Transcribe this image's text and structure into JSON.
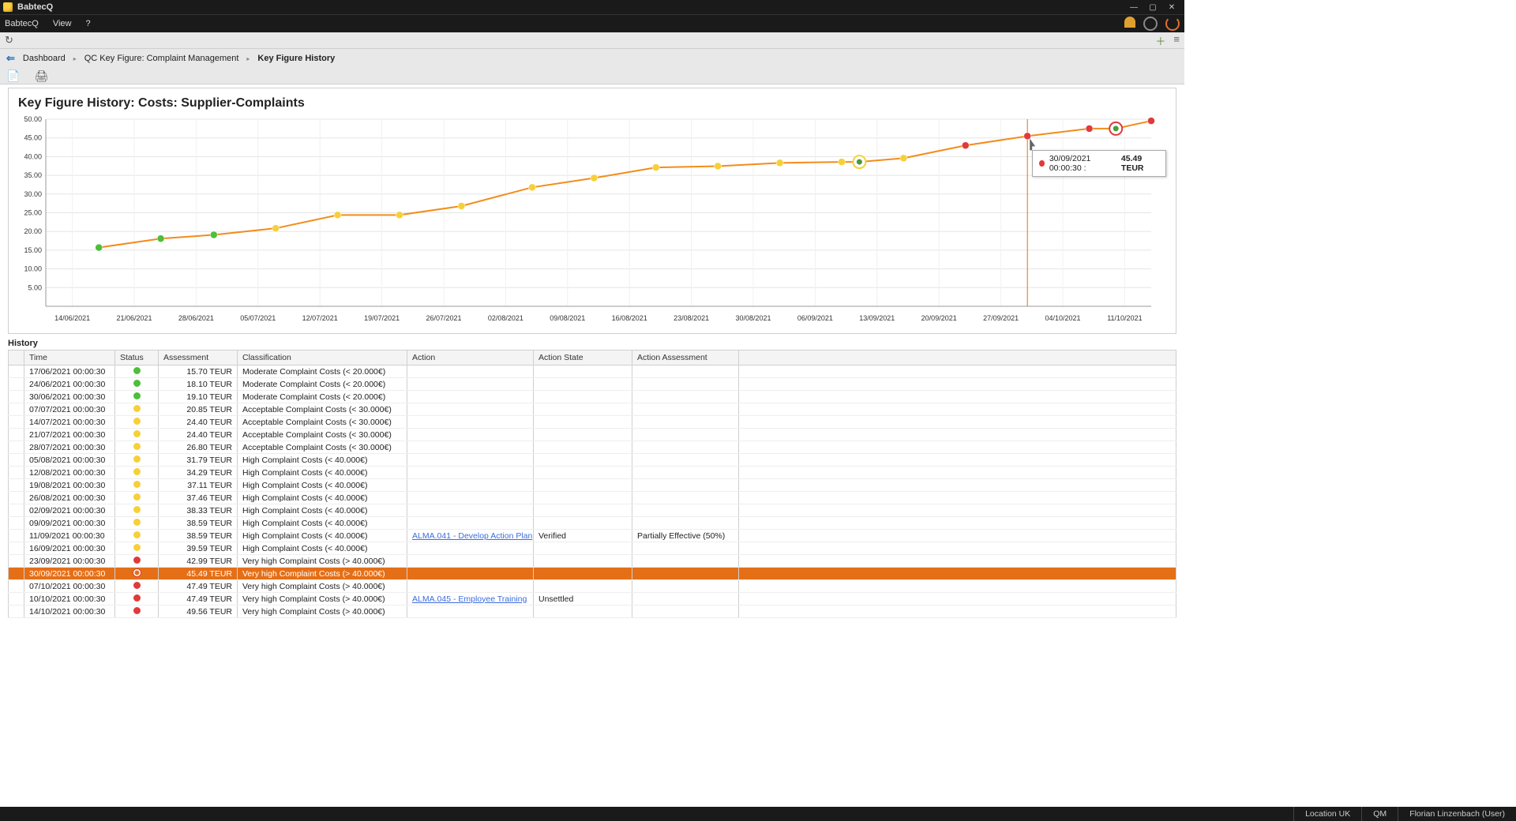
{
  "app": {
    "name": "BabtecQ"
  },
  "menu": {
    "items": [
      "BabtecQ",
      "View",
      "?"
    ]
  },
  "breadcrumb": {
    "items": [
      "Dashboard",
      "QC Key Figure: Complaint Management",
      "Key Figure History"
    ]
  },
  "page_title": "Key Figure History: Costs: Supplier-Complaints",
  "tooltip": {
    "label": "30/09/2021 00:00:30 :",
    "value": "45.49 TEUR"
  },
  "history_label": "History",
  "table": {
    "columns": [
      "",
      "Time",
      "Status",
      "Assessment",
      "Classification",
      "Action",
      "Action State",
      "Action Assessment",
      ""
    ],
    "rows": [
      {
        "time": "17/06/2021 00:00:30",
        "status": "green",
        "assessment": "15.70 TEUR",
        "classification": "Moderate Complaint Costs (< 20.000€)",
        "action": "",
        "action_state": "",
        "action_assessment": ""
      },
      {
        "time": "24/06/2021 00:00:30",
        "status": "green",
        "assessment": "18.10 TEUR",
        "classification": "Moderate Complaint Costs (< 20.000€)",
        "action": "",
        "action_state": "",
        "action_assessment": ""
      },
      {
        "time": "30/06/2021 00:00:30",
        "status": "green",
        "assessment": "19.10 TEUR",
        "classification": "Moderate Complaint Costs (< 20.000€)",
        "action": "",
        "action_state": "",
        "action_assessment": ""
      },
      {
        "time": "07/07/2021 00:00:30",
        "status": "yellow",
        "assessment": "20.85 TEUR",
        "classification": "Acceptable Complaint Costs (< 30.000€)",
        "action": "",
        "action_state": "",
        "action_assessment": ""
      },
      {
        "time": "14/07/2021 00:00:30",
        "status": "yellow",
        "assessment": "24.40 TEUR",
        "classification": "Acceptable Complaint Costs (< 30.000€)",
        "action": "",
        "action_state": "",
        "action_assessment": ""
      },
      {
        "time": "21/07/2021 00:00:30",
        "status": "yellow",
        "assessment": "24.40 TEUR",
        "classification": "Acceptable Complaint Costs (< 30.000€)",
        "action": "",
        "action_state": "",
        "action_assessment": ""
      },
      {
        "time": "28/07/2021 00:00:30",
        "status": "yellow",
        "assessment": "26.80 TEUR",
        "classification": "Acceptable Complaint Costs (< 30.000€)",
        "action": "",
        "action_state": "",
        "action_assessment": ""
      },
      {
        "time": "05/08/2021 00:00:30",
        "status": "yellow",
        "assessment": "31.79 TEUR",
        "classification": "High Complaint Costs (< 40.000€)",
        "action": "",
        "action_state": "",
        "action_assessment": ""
      },
      {
        "time": "12/08/2021 00:00:30",
        "status": "yellow",
        "assessment": "34.29 TEUR",
        "classification": "High Complaint Costs (< 40.000€)",
        "action": "",
        "action_state": "",
        "action_assessment": ""
      },
      {
        "time": "19/08/2021 00:00:30",
        "status": "yellow",
        "assessment": "37.11 TEUR",
        "classification": "High Complaint Costs (< 40.000€)",
        "action": "",
        "action_state": "",
        "action_assessment": ""
      },
      {
        "time": "26/08/2021 00:00:30",
        "status": "yellow",
        "assessment": "37.46 TEUR",
        "classification": "High Complaint Costs (< 40.000€)",
        "action": "",
        "action_state": "",
        "action_assessment": ""
      },
      {
        "time": "02/09/2021 00:00:30",
        "status": "yellow",
        "assessment": "38.33 TEUR",
        "classification": "High Complaint Costs (< 40.000€)",
        "action": "",
        "action_state": "",
        "action_assessment": ""
      },
      {
        "time": "09/09/2021 00:00:30",
        "status": "yellow",
        "assessment": "38.59 TEUR",
        "classification": "High Complaint Costs (< 40.000€)",
        "action": "",
        "action_state": "",
        "action_assessment": ""
      },
      {
        "time": "11/09/2021 00:00:30",
        "status": "yellow",
        "assessment": "38.59 TEUR",
        "classification": "High Complaint Costs (< 40.000€)",
        "action": "ALMA.041 - Develop Action Plan",
        "action_state": "Verified",
        "action_assessment": "Partially Effective (50%)"
      },
      {
        "time": "16/09/2021 00:00:30",
        "status": "yellow",
        "assessment": "39.59 TEUR",
        "classification": "High Complaint Costs (< 40.000€)",
        "action": "",
        "action_state": "",
        "action_assessment": ""
      },
      {
        "time": "23/09/2021 00:00:30",
        "status": "red",
        "assessment": "42.99 TEUR",
        "classification": "Very high Complaint Costs (> 40.000€)",
        "action": "",
        "action_state": "",
        "action_assessment": ""
      },
      {
        "time": "30/09/2021 00:00:30",
        "status": "red",
        "assessment": "45.49 TEUR",
        "classification": "Very high Complaint Costs (> 40.000€)",
        "action": "",
        "action_state": "",
        "action_assessment": "",
        "selected": true
      },
      {
        "time": "07/10/2021 00:00:30",
        "status": "red",
        "assessment": "47.49 TEUR",
        "classification": "Very high Complaint Costs (> 40.000€)",
        "action": "",
        "action_state": "",
        "action_assessment": ""
      },
      {
        "time": "10/10/2021 00:00:30",
        "status": "red",
        "assessment": "47.49 TEUR",
        "classification": "Very high Complaint Costs (> 40.000€)",
        "action": "ALMA.045 - Employee Training",
        "action_state": "Unsettled",
        "action_assessment": ""
      },
      {
        "time": "14/10/2021 00:00:30",
        "status": "red",
        "assessment": "49.56 TEUR",
        "classification": "Very high Complaint Costs (> 40.000€)",
        "action": "",
        "action_state": "",
        "action_assessment": ""
      }
    ]
  },
  "statusbar": {
    "location": "Location UK",
    "module": "QM",
    "user": "Florian Linzenbach (User)"
  },
  "chart_data": {
    "type": "line",
    "title": "Key Figure History: Costs: Supplier-Complaints",
    "xlabel": "",
    "ylabel": "",
    "ylim": [
      0,
      50
    ],
    "yticks": [
      5,
      10,
      15,
      20,
      25,
      30,
      35,
      40,
      45,
      50
    ],
    "x_categories": [
      "14/06/2021",
      "21/06/2021",
      "28/06/2021",
      "05/07/2021",
      "12/07/2021",
      "19/07/2021",
      "26/07/2021",
      "02/08/2021",
      "09/08/2021",
      "16/08/2021",
      "23/08/2021",
      "30/08/2021",
      "06/09/2021",
      "13/09/2021",
      "20/09/2021",
      "27/09/2021",
      "04/10/2021",
      "11/10/2021"
    ],
    "series": [
      {
        "name": "TEUR",
        "line_color": "#f28c1a",
        "points": [
          {
            "x": "17/06/2021",
            "y": 15.7,
            "status": "green"
          },
          {
            "x": "24/06/2021",
            "y": 18.1,
            "status": "green"
          },
          {
            "x": "30/06/2021",
            "y": 19.1,
            "status": "green"
          },
          {
            "x": "07/07/2021",
            "y": 20.85,
            "status": "yellow"
          },
          {
            "x": "14/07/2021",
            "y": 24.4,
            "status": "yellow"
          },
          {
            "x": "21/07/2021",
            "y": 24.4,
            "status": "yellow"
          },
          {
            "x": "28/07/2021",
            "y": 26.8,
            "status": "yellow"
          },
          {
            "x": "05/08/2021",
            "y": 31.79,
            "status": "yellow"
          },
          {
            "x": "12/08/2021",
            "y": 34.29,
            "status": "yellow"
          },
          {
            "x": "19/08/2021",
            "y": 37.11,
            "status": "yellow"
          },
          {
            "x": "26/08/2021",
            "y": 37.46,
            "status": "yellow"
          },
          {
            "x": "02/09/2021",
            "y": 38.33,
            "status": "yellow"
          },
          {
            "x": "09/09/2021",
            "y": 38.59,
            "status": "yellow"
          },
          {
            "x": "11/09/2021",
            "y": 38.59,
            "status": "yellow",
            "marker": "ring"
          },
          {
            "x": "16/09/2021",
            "y": 39.59,
            "status": "yellow"
          },
          {
            "x": "23/09/2021",
            "y": 42.99,
            "status": "red"
          },
          {
            "x": "30/09/2021",
            "y": 45.49,
            "status": "red",
            "selected": true
          },
          {
            "x": "07/10/2021",
            "y": 47.49,
            "status": "red"
          },
          {
            "x": "10/10/2021",
            "y": 47.49,
            "status": "red",
            "marker": "ring"
          },
          {
            "x": "14/10/2021",
            "y": 49.56,
            "status": "red"
          }
        ]
      }
    ],
    "highlight_x": "30/09/2021"
  }
}
